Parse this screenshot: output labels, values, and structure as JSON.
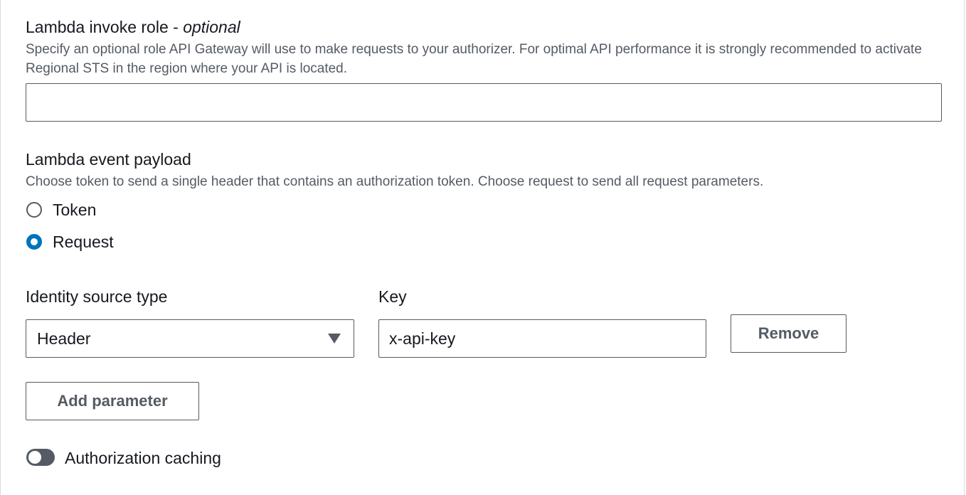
{
  "invoke_role": {
    "label": "Lambda invoke role - ",
    "label_optional": "optional",
    "description": "Specify an optional role API Gateway will use to make requests to your authorizer. For optimal API performance it is strongly recommended to activate Regional STS in the region where your API is located.",
    "value": ""
  },
  "event_payload": {
    "label": "Lambda event payload",
    "description": "Choose token to send a single header that contains an authorization token. Choose request to send all request parameters.",
    "options": [
      {
        "label": "Token",
        "checked": false
      },
      {
        "label": "Request",
        "checked": true
      }
    ]
  },
  "identity_source": {
    "type_label": "Identity source type",
    "type_value": "Header",
    "key_label": "Key",
    "key_value": "x-api-key",
    "remove_label": "Remove",
    "add_label": "Add parameter"
  },
  "caching": {
    "label": "Authorization caching",
    "enabled": false
  },
  "colors": {
    "accent": "#0073bb",
    "text": "#16191f",
    "secondary_text": "#545b64",
    "border": "#545b64"
  }
}
